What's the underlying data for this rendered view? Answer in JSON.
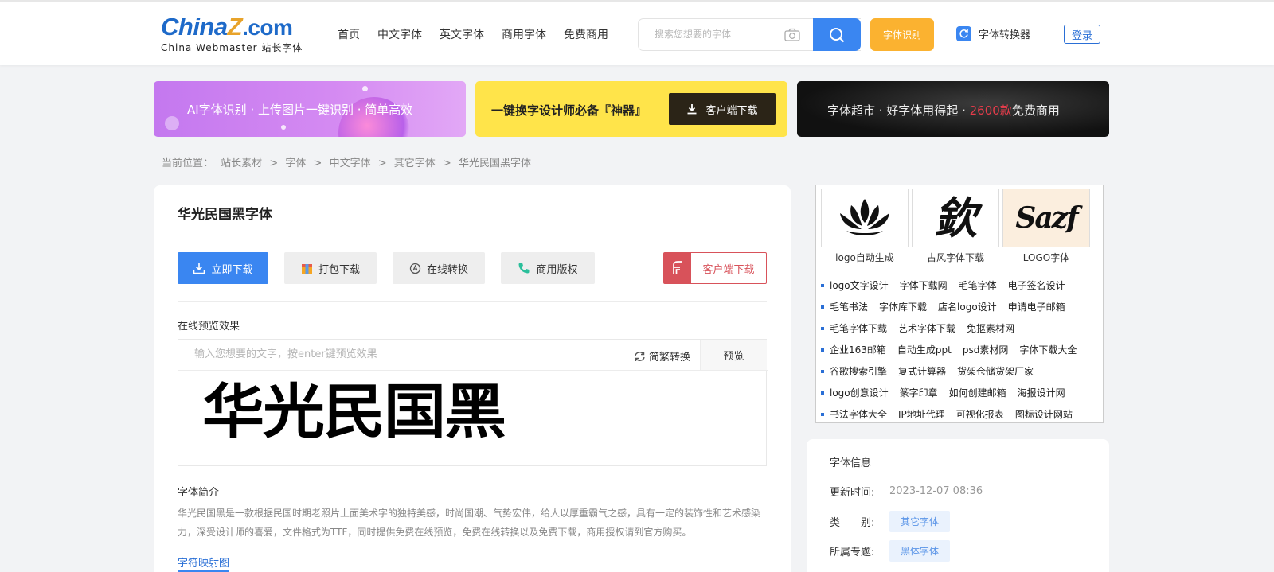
{
  "header": {
    "logo_main_a": "China",
    "logo_main_b": "Z",
    "logo_main_c": ".com",
    "logo_sub": "China Webmaster 站长字体",
    "nav": [
      "首页",
      "中文字体",
      "英文字体",
      "商用字体",
      "免费商用"
    ],
    "search_placeholder": "搜索您想要的字体",
    "font_id_label": "字体识别",
    "converter_label": "字体转换器",
    "login_label": "登录"
  },
  "banners": {
    "b1_text": "AI字体识别 · 上传图片一键识别 · 简单高效",
    "b2_text": "一键换字设计师必备『神器』",
    "b2_button": "客户端下载",
    "b3_text_a": "字体超市 · 好字体用得起 · ",
    "b3_text_red": "2600款",
    "b3_text_b": "免费商用"
  },
  "breadcrumb": [
    "当前位置：",
    "站长素材",
    ">",
    "字体",
    ">",
    "中文字体",
    ">",
    "其它字体",
    ">",
    "华光民国黑字体"
  ],
  "main": {
    "title": "华光民国黑字体",
    "btn_download": "立即下载",
    "btn_pack": "打包下载",
    "btn_convert": "在线转换",
    "btn_license": "商用版权",
    "btn_client": "客户端下载",
    "preview_label": "在线预览效果",
    "preview_placeholder": "输入您想要的文字，按enter键预览效果",
    "convert_link": "简繁转换",
    "preview_button": "预览",
    "preview_text": "华光民国黑",
    "intro_title": "字体简介",
    "intro_text": "华光民国黑是一款根据民国时期老照片上面美术字的独特美感，时尚国潮、气势宏伟，给人以厚重霸气之感，具有一定的装饰性和艺术感染力，深受设计师的喜爱，文件格式为TTF，同时提供免费在线预览，免费在线转换以及免费下载，商用授权请到官方购买。",
    "map_link": "字符映射图"
  },
  "promo": {
    "thumbs": [
      {
        "label": "logo自动生成",
        "art": ""
      },
      {
        "label": "古风字体下载",
        "art": "欽"
      },
      {
        "label": "LOGO字体",
        "art": "Sazf"
      }
    ],
    "rows": [
      [
        "logo文字设计",
        "字体下载网",
        "毛笔字体",
        "电子签名设计"
      ],
      [
        "毛笔书法",
        "字体库下载",
        "店名logo设计",
        "申请电子邮箱"
      ],
      [
        "毛笔字体下载",
        "艺术字体下载",
        "免抠素材网"
      ],
      [
        "企业163邮箱",
        "自动生成ppt",
        "psd素材网",
        "字体下载大全"
      ],
      [
        "谷歌搜索引擎",
        "复式计算器",
        "货架仓储货架厂家"
      ],
      [
        "logo创意设计",
        "篆字印章",
        "如何创建邮箱",
        "海报设计网"
      ],
      [
        "书法字体大全",
        "IP地址代理",
        "可视化报表",
        "图标设计网站"
      ]
    ]
  },
  "info": {
    "title": "字体信息",
    "updated_key": "更新时间:",
    "updated_val": "2023-12-07 08:36",
    "category_key": "类　　别:",
    "category_val": "其它字体",
    "topic_key": "所属专题:",
    "topic_val": "黑体字体"
  },
  "colors": {
    "accent_blue": "#3a86f1",
    "accent_orange": "#fbb230",
    "client_red": "#d8525a",
    "banner_yellow": "#ffe44a"
  }
}
